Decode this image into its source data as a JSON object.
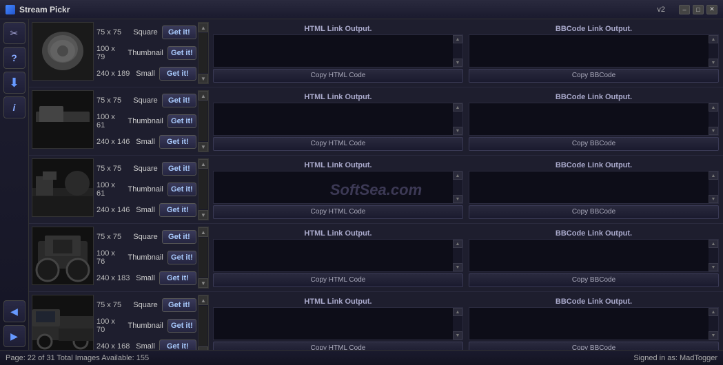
{
  "titlebar": {
    "icon": "stream-icon",
    "title": "Stream Pickr",
    "version": "v2",
    "minimize": "–",
    "maximize": "□",
    "close": "✕"
  },
  "sidebar": {
    "buttons": [
      {
        "id": "scissors-btn",
        "icon": "✂",
        "label": "scissors-icon"
      },
      {
        "id": "help-btn",
        "icon": "?",
        "label": "help-icon"
      },
      {
        "id": "download-btn",
        "icon": "↓",
        "label": "download-icon"
      },
      {
        "id": "info-btn",
        "icon": "i",
        "label": "info-icon"
      },
      {
        "id": "back-btn",
        "icon": "◀",
        "label": "back-icon"
      },
      {
        "id": "forward-btn",
        "icon": "▶",
        "label": "forward-icon"
      }
    ]
  },
  "rows": [
    {
      "id": "row-1",
      "thumb_class": "thumb-1",
      "sizes": [
        {
          "dims": "75 x 75",
          "label": "Square",
          "btn": "Get it!"
        },
        {
          "dims": "100 x 79",
          "label": "Thumbnail",
          "btn": "Get it!"
        },
        {
          "dims": "240 x 189",
          "label": "Small",
          "btn": "Get it!"
        }
      ],
      "html_output_label": "HTML Link Output.",
      "bbcode_output_label": "BBCode Link Output.",
      "copy_html": "Copy HTML Code",
      "copy_bbcode": "Copy BBCode"
    },
    {
      "id": "row-2",
      "thumb_class": "thumb-2",
      "sizes": [
        {
          "dims": "75 x 75",
          "label": "Square",
          "btn": "Get it!"
        },
        {
          "dims": "100 x 61",
          "label": "Thumbnail",
          "btn": "Get it!"
        },
        {
          "dims": "240 x 146",
          "label": "Small",
          "btn": "Get it!"
        }
      ],
      "html_output_label": "HTML Link Output.",
      "bbcode_output_label": "BBCode Link Output.",
      "copy_html": "Copy HTML Code",
      "copy_bbcode": "Copy BBCode"
    },
    {
      "id": "row-3",
      "thumb_class": "thumb-3",
      "sizes": [
        {
          "dims": "75 x 75",
          "label": "Square",
          "btn": "Get it!"
        },
        {
          "dims": "100 x 61",
          "label": "Thumbnail",
          "btn": "Get it!"
        },
        {
          "dims": "240 x 146",
          "label": "Small",
          "btn": "Get it!"
        }
      ],
      "html_output_label": "HTML Link Output.",
      "bbcode_output_label": "BBCode Link Output.",
      "copy_html": "Copy HTML Code",
      "copy_bbcode": "Copy BBCode"
    },
    {
      "id": "row-4",
      "thumb_class": "thumb-4",
      "sizes": [
        {
          "dims": "75 x 75",
          "label": "Square",
          "btn": "Get it!"
        },
        {
          "dims": "100 x 76",
          "label": "Thumbnail",
          "btn": "Get it!"
        },
        {
          "dims": "240 x 183",
          "label": "Small",
          "btn": "Get it!"
        }
      ],
      "html_output_label": "HTML Link Output.",
      "bbcode_output_label": "BBCode Link Output.",
      "copy_html": "Copy HTML Code",
      "copy_bbcode": "Copy BBCode"
    },
    {
      "id": "row-5",
      "thumb_class": "thumb-5",
      "sizes": [
        {
          "dims": "75 x 75",
          "label": "Square",
          "btn": "Get it!"
        },
        {
          "dims": "100 x 70",
          "label": "Thumbnail",
          "btn": "Get it!"
        },
        {
          "dims": "240 x 168",
          "label": "Small",
          "btn": "Get it!"
        }
      ],
      "html_output_label": "HTML Link Output.",
      "bbcode_output_label": "BBCode Link Output.",
      "copy_html": "Copy HTML Code",
      "copy_bbcode": "Copy BBCode"
    }
  ],
  "watermark": "SoftSea.com",
  "statusbar": {
    "left": "Page: 22 of 31   Total Images Available: 155",
    "right": "Signed in as: MadTogger"
  }
}
